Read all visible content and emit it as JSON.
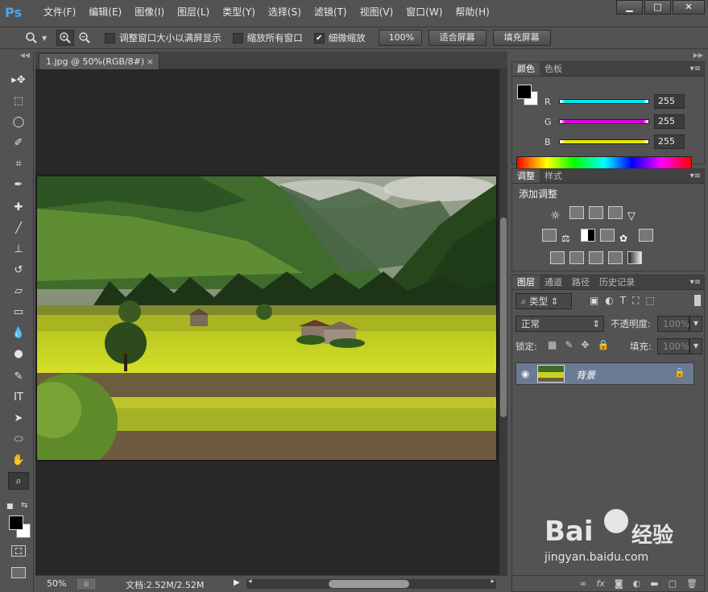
{
  "app": {
    "logo": "Ps"
  },
  "menu": [
    "文件(F)",
    "编辑(E)",
    "图像(I)",
    "图层(L)",
    "类型(Y)",
    "选择(S)",
    "滤镜(T)",
    "视图(V)",
    "窗口(W)",
    "帮助(H)"
  ],
  "window_controls": {
    "minimize": "▁",
    "maximize": "□",
    "close": "✕"
  },
  "options_bar": {
    "resize_windows": "调整窗口大小以满屏显示",
    "zoom_all": "缩放所有窗口",
    "scrubby_zoom": "细微缩放",
    "pct_button": "100%",
    "fit_screen": "适合屏幕",
    "fill_screen": "填充屏幕"
  },
  "document": {
    "tab_title": "1.jpg @ 50%(RGB/8#)",
    "tab_close": "×"
  },
  "status": {
    "zoom": "50%",
    "doc_info": "文档:2.52M/2.52M"
  },
  "color_panel": {
    "tabs": [
      "颜色",
      "色板"
    ],
    "channels": [
      {
        "label": "R",
        "value": "255",
        "gradient": "#00e5e5"
      },
      {
        "label": "G",
        "value": "255",
        "gradient": "#e000e0"
      },
      {
        "label": "B",
        "value": "255",
        "gradient": "#e8e800"
      }
    ]
  },
  "adjust_panel": {
    "tabs": [
      "调整",
      "样式"
    ],
    "title": "添加调整"
  },
  "layers_panel": {
    "tabs": [
      "图层",
      "通道",
      "路径",
      "历史记录"
    ],
    "filter_kind": "类型",
    "blend_mode": "正常",
    "opacity_label": "不透明度:",
    "opacity_value": "100%",
    "lock_label": "锁定:",
    "fill_label": "填充:",
    "fill_value": "100%",
    "layer_name": "背景"
  },
  "watermark": {
    "brand": "Bai",
    "brand2": "经验",
    "url": "jingyan.baidu.com"
  }
}
